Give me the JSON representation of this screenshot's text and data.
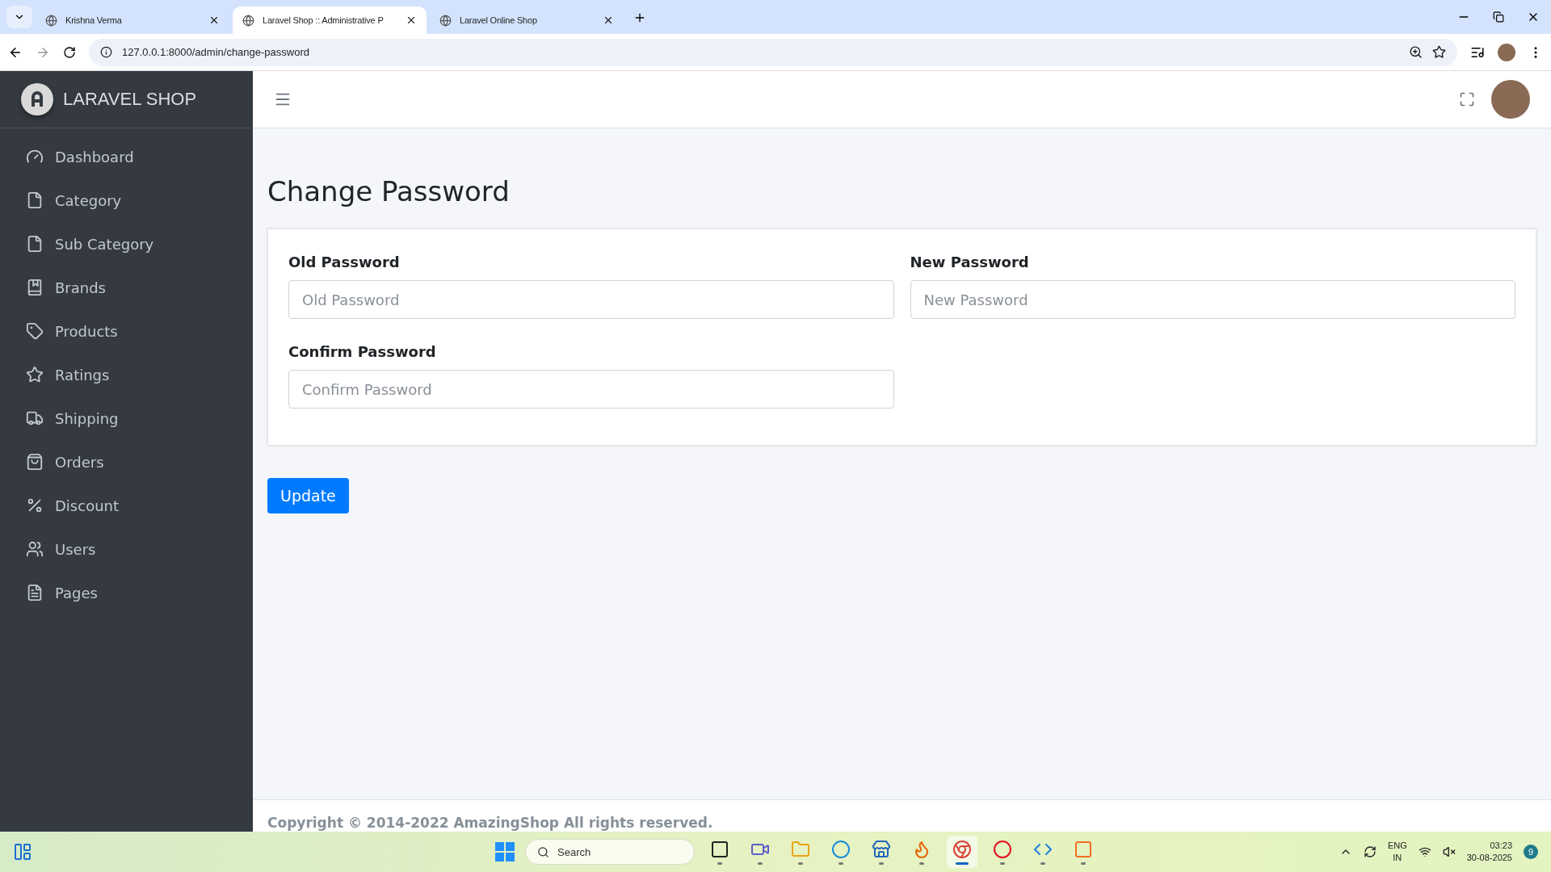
{
  "browser": {
    "tabs": [
      {
        "title": "Krishna Verma",
        "selected": false
      },
      {
        "title": "Laravel Shop :: Administrative P",
        "selected": true
      },
      {
        "title": "Laravel Online Shop",
        "selected": false
      }
    ],
    "address": "127.0.0.1:8000/admin/change-password"
  },
  "sidebar": {
    "brand": "LARAVEL SHOP",
    "items": [
      {
        "label": "Dashboard",
        "kind": "gauge"
      },
      {
        "label": "Category",
        "kind": "file"
      },
      {
        "label": "Sub Category",
        "kind": "file"
      },
      {
        "label": "Brands",
        "kind": "bookmark"
      },
      {
        "label": "Products",
        "kind": "tag"
      },
      {
        "label": "Ratings",
        "kind": "star"
      },
      {
        "label": "Shipping",
        "kind": "truck"
      },
      {
        "label": "Orders",
        "kind": "bag"
      },
      {
        "label": "Discount",
        "kind": "percent"
      },
      {
        "label": "Users",
        "kind": "users"
      },
      {
        "label": "Pages",
        "kind": "page"
      }
    ]
  },
  "page": {
    "title": "Change Password",
    "fields": [
      {
        "label": "Old Password",
        "placeholder": "Old Password"
      },
      {
        "label": "New Password",
        "placeholder": "New Password"
      },
      {
        "label": "Confirm Password",
        "placeholder": "Confirm Password"
      }
    ],
    "button": "Update"
  },
  "footer": "Copyright © 2014-2022 AmazingShop All rights reserved.",
  "taskbar": {
    "search": "Search",
    "apps": [
      {
        "kind": "taskview",
        "selected": false
      },
      {
        "kind": "chat",
        "selected": false
      },
      {
        "kind": "folder",
        "selected": false
      },
      {
        "kind": "edge",
        "selected": false
      },
      {
        "kind": "store",
        "selected": false
      },
      {
        "kind": "firefox",
        "selected": false
      },
      {
        "kind": "chrome",
        "selected": true
      },
      {
        "kind": "opera",
        "selected": false
      },
      {
        "kind": "code",
        "selected": false
      },
      {
        "kind": "xampp",
        "selected": false
      }
    ],
    "language": "ENG",
    "region": "IN",
    "time": "03:23",
    "date": "30-08-2025",
    "notifications": "9"
  }
}
